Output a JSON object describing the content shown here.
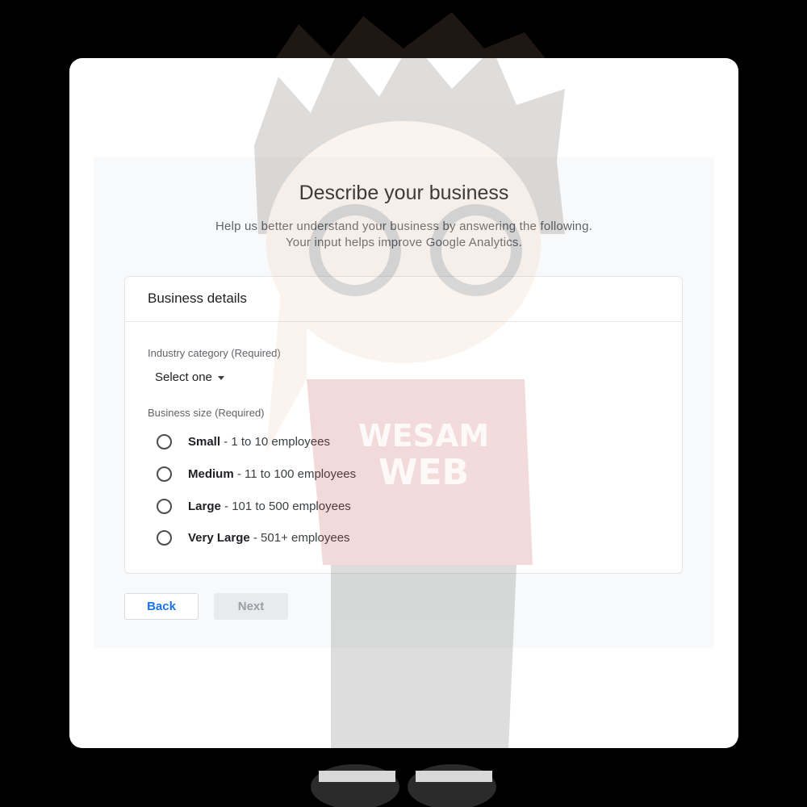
{
  "page": {
    "title": "Describe your business",
    "subtitle_line1": "Help us better understand your business by answering the following.",
    "subtitle_line2": "Your input helps improve Google Analytics."
  },
  "business_details": {
    "heading": "Business details",
    "industry": {
      "label": "Industry category (Required)",
      "selected": "Select one"
    },
    "size": {
      "label": "Business size (Required)",
      "options": [
        {
          "name": "Small",
          "detail": " - 1 to 10 employees",
          "selected": false
        },
        {
          "name": "Medium",
          "detail": " - 11 to 100 employees",
          "selected": false
        },
        {
          "name": "Large",
          "detail": " - 101 to 500 employees",
          "selected": false
        },
        {
          "name": "Very Large",
          "detail": " - 501+ employees",
          "selected": false
        }
      ]
    }
  },
  "buttons": {
    "back": "Back",
    "next": "Next"
  },
  "watermark": {
    "shirt_text": "WESAM WEB"
  },
  "colors": {
    "accent": "#1a73e8",
    "background": "#000000",
    "card": "#ffffff",
    "panel": "#f8f9fa",
    "disabled": "#e8eaed"
  }
}
